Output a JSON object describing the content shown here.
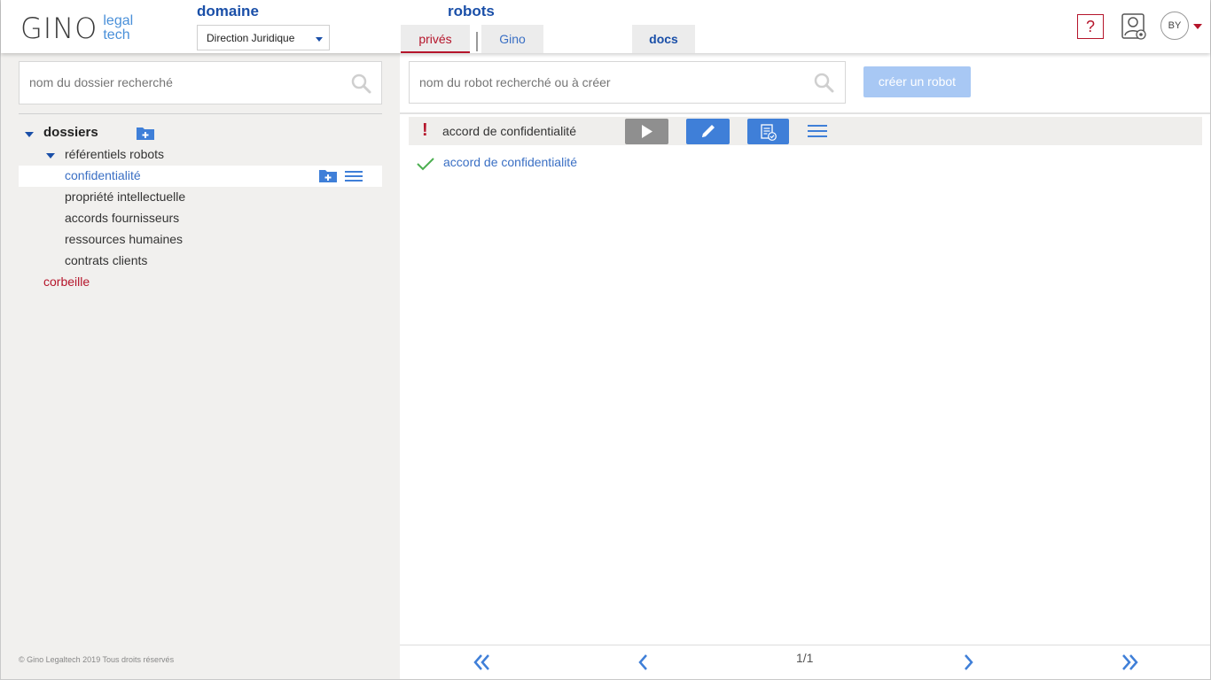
{
  "header": {
    "logo_main": "GINO",
    "logo_sub_1": "legal",
    "logo_sub_2": "tech",
    "domain_label": "domaine",
    "domain_value": "Direction Juridique",
    "robots_label": "robots",
    "tabs": [
      {
        "label": "privés",
        "active": true
      },
      {
        "label": "Gino",
        "active": false
      },
      {
        "label": "docs",
        "active": false
      }
    ],
    "help_label": "?",
    "avatar_initials": "BY"
  },
  "left": {
    "search_placeholder": "nom du dossier recherché",
    "tree": {
      "root_label": "dossiers",
      "group_label": "référentiels robots",
      "items": [
        {
          "label": "confidentialité",
          "selected": true
        },
        {
          "label": "propriété intellectuelle",
          "selected": false
        },
        {
          "label": "accords fournisseurs",
          "selected": false
        },
        {
          "label": "ressources humaines",
          "selected": false
        },
        {
          "label": "contrats clients",
          "selected": false
        }
      ],
      "trash_label": "corbeille"
    },
    "footer": "© Gino Legaltech 2019 Tous droits réservés"
  },
  "right": {
    "search_placeholder": "nom du robot recherché ou à créer",
    "create_button": "créer un robot",
    "robot": {
      "warning_mark": "!",
      "name": "accord de confidentialité"
    },
    "robot_doc_link": "accord de confidentialité",
    "pagination": "1/1"
  },
  "colors": {
    "brand_blue": "#1a4fa8",
    "link_blue": "#3a6fc4",
    "accent_red": "#b5152b",
    "button_blue": "#3f7fd8",
    "check_green": "#4caf50"
  }
}
